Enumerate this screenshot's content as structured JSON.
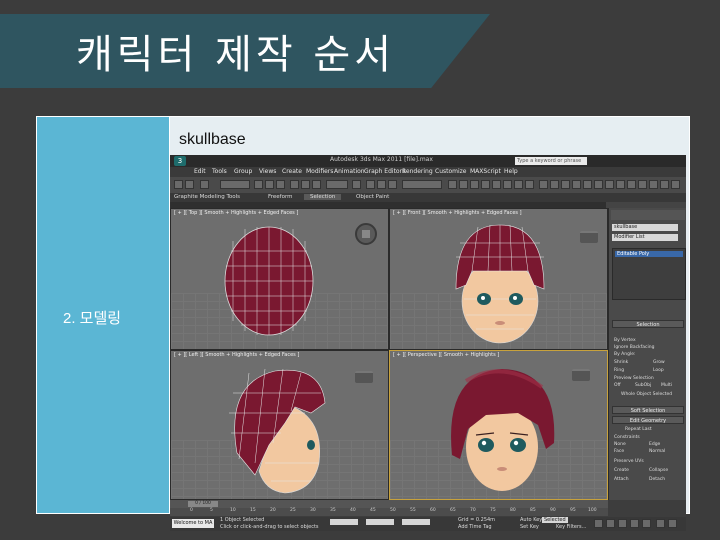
{
  "slide": {
    "title": "캐릭터 제작 순서",
    "image_caption": "skullbase",
    "step_label": "2. 모델링"
  },
  "colors": {
    "title_band": "#2f5560",
    "side_panel": "#5bb6d4",
    "hair": "#7a1830",
    "skin": "#f2c8a0",
    "active_viewport": "#c8a23c"
  },
  "app": {
    "window_title": "Autodesk 3ds Max  2011      [file].max",
    "search_placeholder": "Type a keyword or phrase",
    "menus": [
      "Edit",
      "Tools",
      "Group",
      "Views",
      "Create",
      "Modifiers",
      "Animation",
      "Graph Editors",
      "Rendering",
      "Customize",
      "MAXScript",
      "Help"
    ],
    "ribbon_left": "Graphite Modeling Tools",
    "ribbon_tabs": [
      "Freeform",
      "Selection",
      "Object Paint"
    ],
    "ribbon_selected": "Selection",
    "viewports": [
      {
        "label": "[ + ][ Top ][ Smooth + Highlights + Edged Faces ]"
      },
      {
        "label": "[ + ][ Front ][ Smooth + Highlights + Edged Faces ]"
      },
      {
        "label": "[ + ][ Left ][ Smooth + Highlights + Edged Faces ]"
      },
      {
        "label": "[ + ][ Perspective ][ Smooth + Highlights ]"
      }
    ],
    "command_panel": {
      "object_name": "skullbase",
      "modifier_list": "Modifier List",
      "stack_item": "Editable Poly",
      "rollouts": [
        "Selection",
        "Soft Selection",
        "Edit Geometry"
      ],
      "options": [
        "By Vertex",
        "Ignore Backfacing",
        "By Angle:",
        "Shrink",
        "Grow",
        "Ring",
        "Loop",
        "Preview Selection",
        "Off",
        "SubObj",
        "Multi",
        "Whole Object Selected",
        "Repeat Last",
        "Constraints",
        "None",
        "Edge",
        "Face",
        "Normal",
        "Preserve UVs",
        "Create",
        "Collapse",
        "Attach",
        "Detach"
      ]
    },
    "timeline": {
      "frame_display": "0 / 100",
      "ticks": [
        "0",
        "5",
        "10",
        "15",
        "20",
        "25",
        "30",
        "35",
        "40",
        "45",
        "50",
        "55",
        "60",
        "65",
        "70",
        "75",
        "80",
        "85",
        "90",
        "95",
        "100"
      ]
    },
    "status": {
      "welcome": "Welcome to MA",
      "selection": "1 Object Selected",
      "prompt": "Click or click-and-drag to select objects",
      "grid": "Grid = 0.254m",
      "add_time_tag": "Add Time Tag",
      "auto_key": "Auto Key",
      "selected": "Selected",
      "set_key": "Set Key",
      "key_filters": "Key Filters..."
    }
  }
}
